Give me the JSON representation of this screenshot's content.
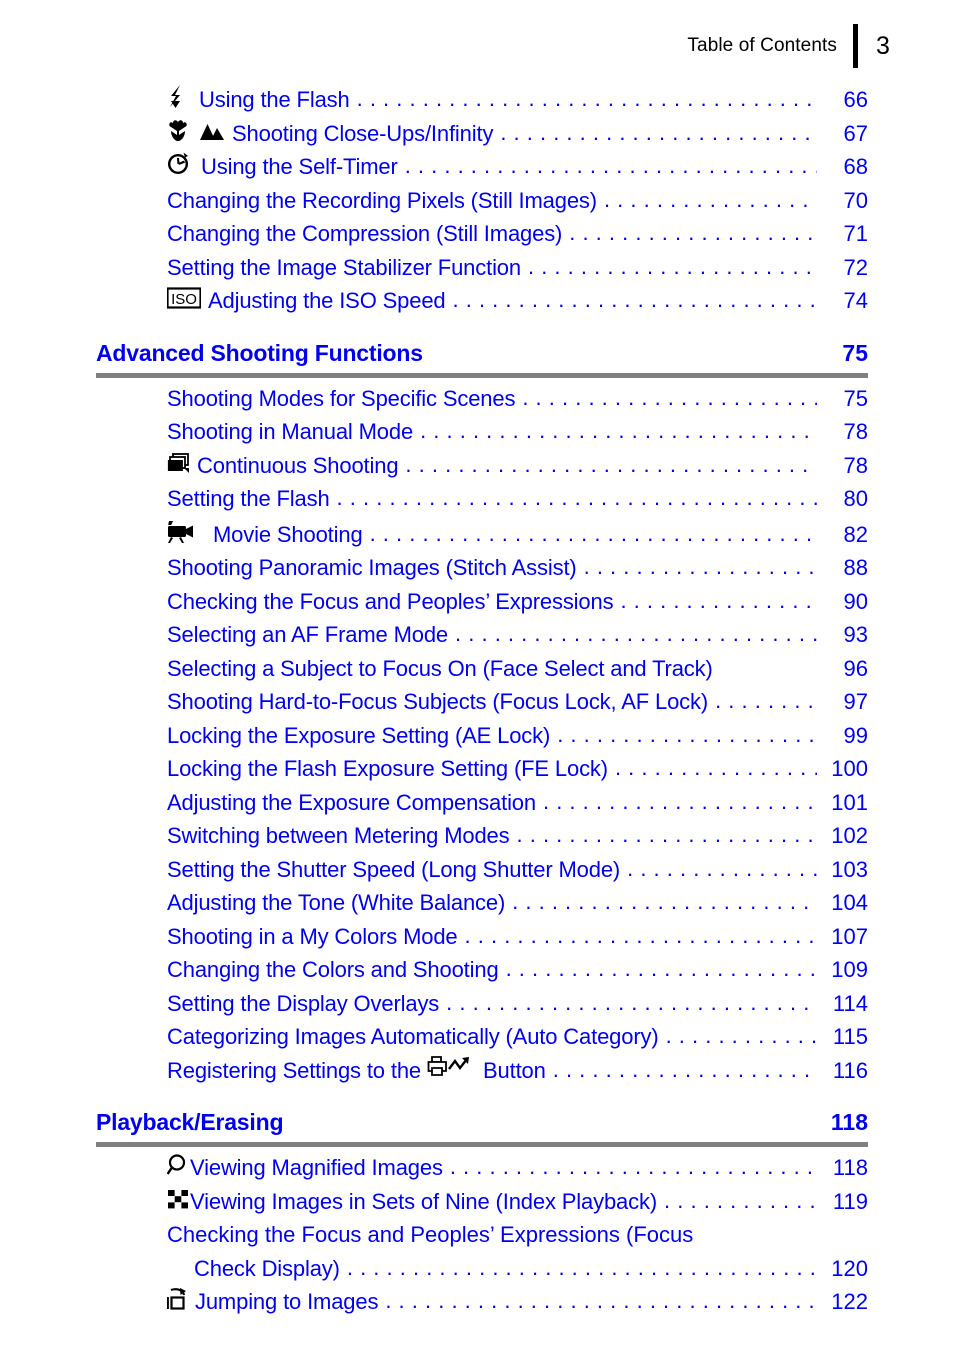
{
  "header": {
    "title": "Table of Contents",
    "page_number": "3"
  },
  "colors": {
    "link_blue": "#0000ee",
    "rule_gray": "#808080",
    "icon_black": "#000000"
  },
  "sections": [
    {
      "id": "continued-basic",
      "title": null,
      "page": null,
      "entries": [
        {
          "icon": "flash-icon",
          "title": "Using the Flash",
          "page": "66"
        },
        {
          "icon": "macro-infinity-icons",
          "title": "Shooting Close-Ups/Infinity",
          "page": "67"
        },
        {
          "icon": "self-timer-icon",
          "title": "Using the Self-Timer",
          "page": "68"
        },
        {
          "icon": null,
          "title": "Changing the Recording Pixels (Still Images)",
          "page": "70"
        },
        {
          "icon": null,
          "title": "Changing the Compression (Still Images)",
          "page": "71"
        },
        {
          "icon": null,
          "title": "Setting the Image Stabilizer Function",
          "page": "72"
        },
        {
          "icon": "iso-icon",
          "title": "Adjusting the ISO Speed",
          "page": "74"
        }
      ]
    },
    {
      "id": "advanced-shooting-functions",
      "title": "Advanced Shooting Functions",
      "page": "75",
      "entries": [
        {
          "icon": null,
          "title": "Shooting Modes for Specific Scenes",
          "page": "75"
        },
        {
          "icon": null,
          "title": "Shooting in Manual Mode",
          "page": "78"
        },
        {
          "icon": "continuous-shooting-icon",
          "title": "Continuous Shooting",
          "page": "78"
        },
        {
          "icon": null,
          "title": "Setting the Flash",
          "page": "80"
        },
        {
          "icon": "movie-camera-icon",
          "title": "Movie Shooting",
          "page": "82"
        },
        {
          "icon": null,
          "title": "Shooting Panoramic Images (Stitch Assist)",
          "page": "88"
        },
        {
          "icon": null,
          "title": "Checking the Focus and Peoples’ Expressions",
          "page": "90"
        },
        {
          "icon": null,
          "title": "Selecting an AF Frame Mode",
          "page": "93"
        },
        {
          "icon": null,
          "title": "Selecting a Subject to Focus On (Face Select and Track)",
          "page": "96",
          "no_leader": true
        },
        {
          "icon": null,
          "title": "Shooting Hard-to-Focus Subjects (Focus Lock, AF Lock)",
          "page": "97",
          "short_leader": true
        },
        {
          "icon": null,
          "title": "Locking the Exposure Setting (AE Lock)",
          "page": "99"
        },
        {
          "icon": null,
          "title": "Locking the Flash Exposure Setting (FE Lock)",
          "page": "100"
        },
        {
          "icon": null,
          "title": "Adjusting the Exposure Compensation",
          "page": "101"
        },
        {
          "icon": null,
          "title": "Switching between Metering Modes",
          "page": "102"
        },
        {
          "icon": null,
          "title": "Setting the Shutter Speed (Long Shutter Mode)",
          "page": "103"
        },
        {
          "icon": null,
          "title": "Adjusting the Tone (White Balance)",
          "page": "104"
        },
        {
          "icon": null,
          "title": "Shooting in a My Colors Mode",
          "page": "107"
        },
        {
          "icon": null,
          "title": "Changing the Colors and Shooting",
          "page": "109"
        },
        {
          "icon": null,
          "title": "Setting the Display Overlays",
          "page": "114"
        },
        {
          "icon": null,
          "title": "Categorizing Images Automatically (Auto Category)",
          "page": "115"
        },
        {
          "icon": null,
          "title_before_icon": "Registering Settings to the",
          "inline_icon": "print-share-button-icon",
          "title_after_icon": "Button",
          "page": "116"
        }
      ]
    },
    {
      "id": "playback-erasing",
      "title": "Playback/Erasing",
      "page": "118",
      "entries": [
        {
          "icon": "magnify-icon",
          "title": "Viewing Magnified Images",
          "page": "118"
        },
        {
          "icon": "index-playback-icon",
          "title": "Viewing Images in Sets of Nine (Index Playback)",
          "page": "119"
        },
        {
          "icon": null,
          "wrapped": true,
          "line1": "Checking the Focus and Peoples’ Expressions (Focus",
          "line2": "Check Display)",
          "page": "120"
        },
        {
          "icon": "jump-icon",
          "title": "Jumping to Images",
          "page": "122"
        }
      ]
    }
  ]
}
